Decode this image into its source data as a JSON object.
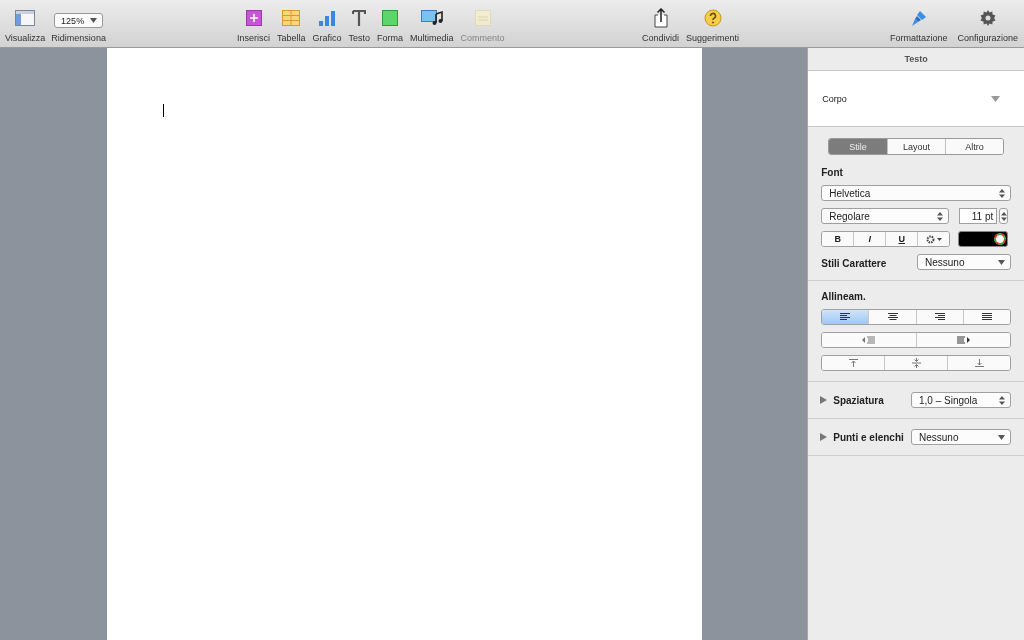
{
  "toolbar": {
    "left": [
      {
        "kind": "view",
        "label": "Visualizza"
      },
      {
        "kind": "zoom",
        "label": "Ridimensiona",
        "value": "125%"
      }
    ],
    "insert": [
      {
        "kind": "insert",
        "label": "Inserisci",
        "disabled": false
      },
      {
        "kind": "table",
        "label": "Tabella",
        "disabled": false
      },
      {
        "kind": "chart",
        "label": "Grafico",
        "disabled": false
      },
      {
        "kind": "text",
        "label": "Testo",
        "disabled": false
      },
      {
        "kind": "shape",
        "label": "Forma",
        "disabled": false
      },
      {
        "kind": "media",
        "label": "Multimedia",
        "disabled": false
      },
      {
        "kind": "comment",
        "label": "Commento",
        "disabled": true
      }
    ],
    "share": [
      {
        "kind": "share",
        "label": "Condividi"
      },
      {
        "kind": "tips",
        "label": "Suggerimenti"
      }
    ],
    "right": [
      {
        "kind": "brush",
        "label": "Formattazione"
      },
      {
        "kind": "gear",
        "label": "Configurazione"
      }
    ]
  },
  "panel": {
    "title": "Testo",
    "paragraph_style": "Corpo",
    "tabs": [
      {
        "label": "Stile",
        "selected": true
      },
      {
        "label": "Layout",
        "selected": false
      },
      {
        "label": "Altro",
        "selected": false
      }
    ],
    "font": {
      "heading": "Font",
      "family": "Helvetica",
      "typeface": "Regolare",
      "size": "11 pt",
      "style_buttons": [
        {
          "kind": "bold",
          "label": "B"
        },
        {
          "kind": "italic",
          "label": "I"
        },
        {
          "kind": "underline",
          "label": "U"
        }
      ],
      "char_styles_label": "Stili Carattere",
      "char_styles_value": "Nessuno"
    },
    "alignment": {
      "heading": "Allineam.",
      "buttons": [
        {
          "kind": "left",
          "selected": true
        },
        {
          "kind": "center",
          "selected": false
        },
        {
          "kind": "right",
          "selected": false
        },
        {
          "kind": "justify",
          "selected": false
        }
      ]
    },
    "spacing": {
      "label": "Spaziatura",
      "value": "1,0 – Singola",
      "expanded": false
    },
    "bullets": {
      "label": "Punti e elenchi",
      "value": "Nessuno",
      "expanded": false
    }
  }
}
